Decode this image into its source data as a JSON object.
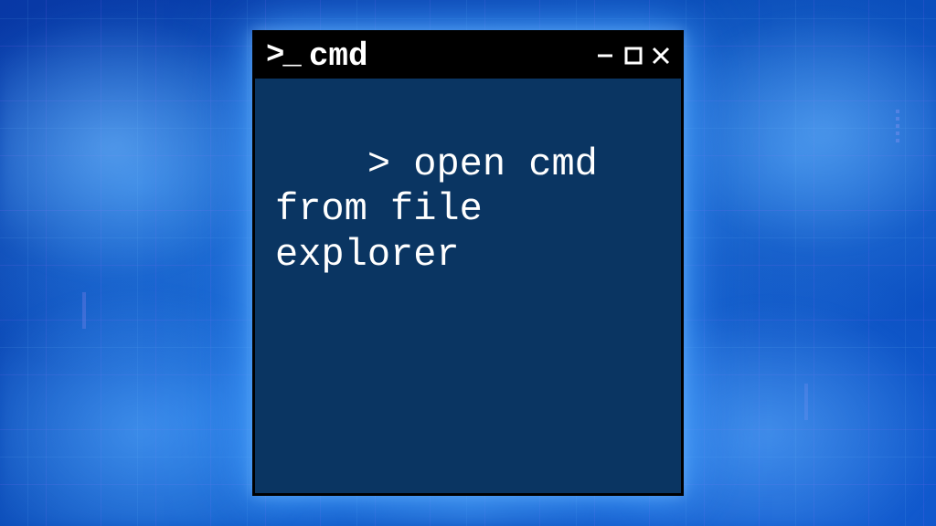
{
  "window": {
    "title": "cmd",
    "prompt_icon": ">_",
    "content": "> open cmd from file explorer"
  },
  "colors": {
    "terminal_bg": "#0a3562",
    "titlebar_bg": "#000000",
    "text": "#ffffff",
    "glow": "#50aaff"
  }
}
